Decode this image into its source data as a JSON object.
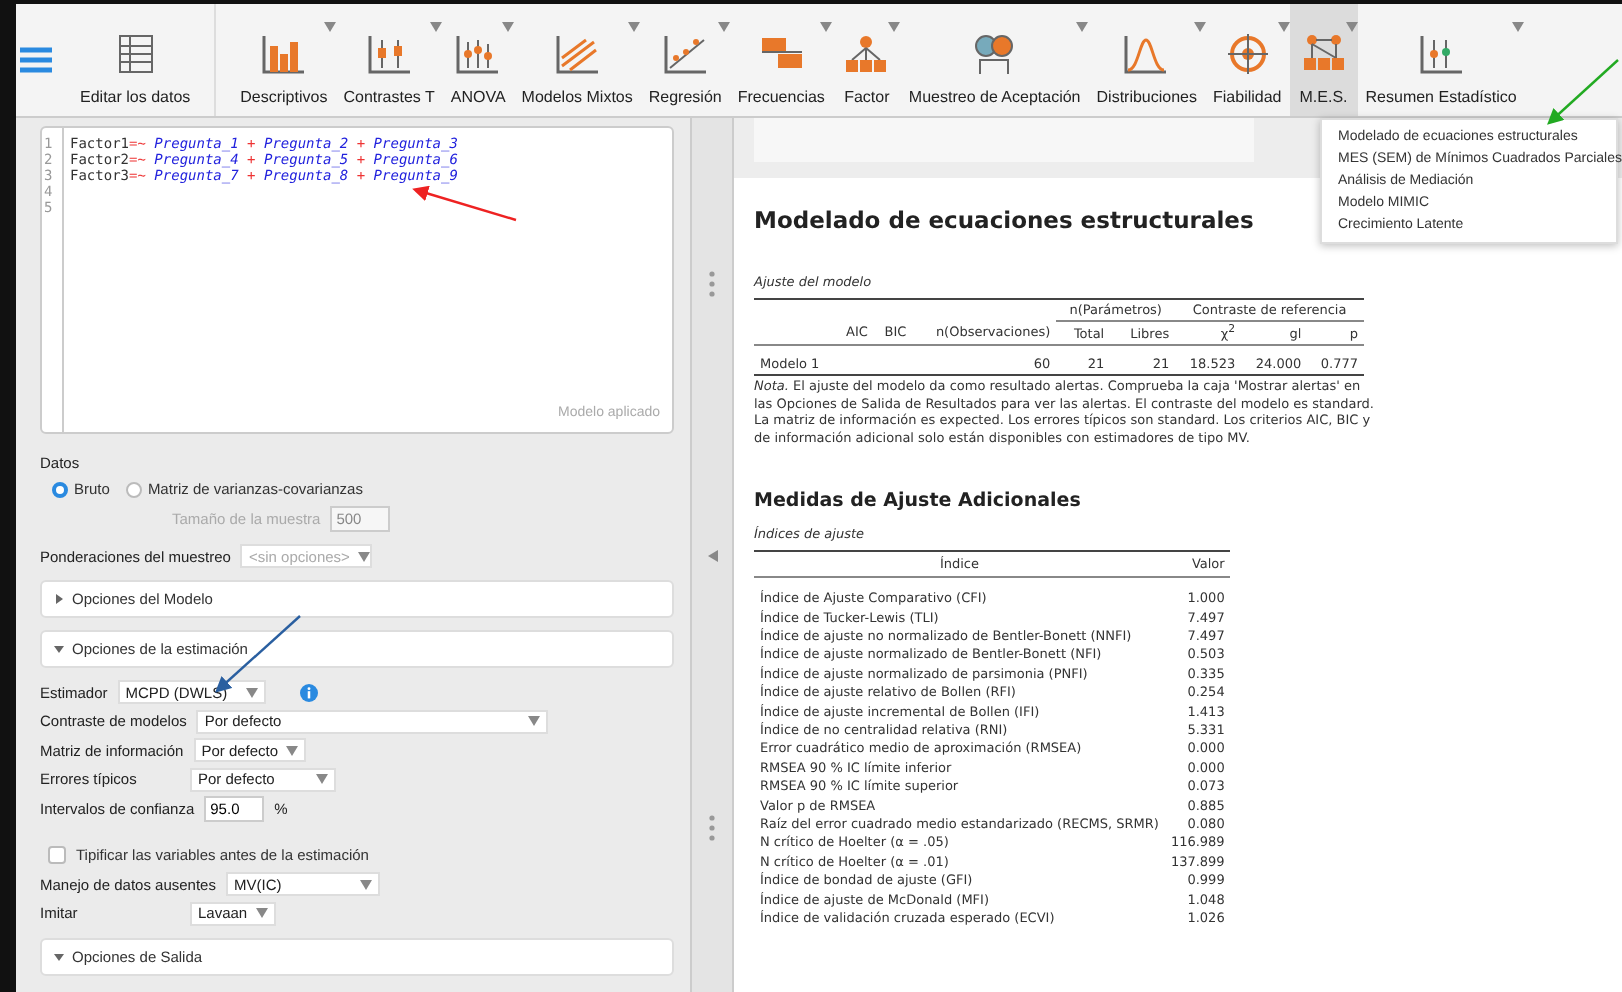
{
  "toolbar": {
    "items": [
      {
        "label": "Editar los datos",
        "has_menu": false,
        "selected": false
      },
      {
        "label": "Descriptivos",
        "has_menu": true,
        "selected": false
      },
      {
        "label": "Contrastes T",
        "has_menu": true,
        "selected": false
      },
      {
        "label": "ANOVA",
        "has_menu": true,
        "selected": false
      },
      {
        "label": "Modelos Mixtos",
        "has_menu": true,
        "selected": false
      },
      {
        "label": "Regresión",
        "has_menu": true,
        "selected": false
      },
      {
        "label": "Frecuencias",
        "has_menu": true,
        "selected": false
      },
      {
        "label": "Factor",
        "has_menu": true,
        "selected": false
      },
      {
        "label": "Muestreo de Aceptación",
        "has_menu": true,
        "selected": false
      },
      {
        "label": "Distribuciones",
        "has_menu": true,
        "selected": false
      },
      {
        "label": "Fiabilidad",
        "has_menu": true,
        "selected": false
      },
      {
        "label": "M.E.S.",
        "has_menu": true,
        "selected": true
      },
      {
        "label": "Resumen Estadístico",
        "has_menu": true,
        "selected": false
      }
    ]
  },
  "dropdown_menu": {
    "items": [
      "Modelado de ecuaciones estructurales",
      "MES (SEM) de Mínimos Cuadrados Parciales",
      "Análisis de Mediación",
      "Modelo MIMIC",
      "Crecimiento Latente"
    ]
  },
  "editor": {
    "line_numbers": [
      "1",
      "2",
      "3",
      "4",
      "5"
    ],
    "lines": [
      [
        {
          "kind": "name",
          "text": "Factor1"
        },
        {
          "kind": "op",
          "text": "=~"
        },
        {
          "kind": "var",
          "text": "Pregunta_1"
        },
        {
          "kind": "op",
          "text": "+"
        },
        {
          "kind": "var",
          "text": "Pregunta_2"
        },
        {
          "kind": "op",
          "text": "+"
        },
        {
          "kind": "var",
          "text": "Pregunta_3"
        }
      ],
      [
        {
          "kind": "name",
          "text": "Factor2"
        },
        {
          "kind": "op",
          "text": "=~"
        },
        {
          "kind": "var",
          "text": "Pregunta_4"
        },
        {
          "kind": "op",
          "text": "+"
        },
        {
          "kind": "var",
          "text": "Pregunta_5"
        },
        {
          "kind": "op",
          "text": "+"
        },
        {
          "kind": "var",
          "text": "Pregunta_6"
        }
      ],
      [
        {
          "kind": "name",
          "text": "Factor3"
        },
        {
          "kind": "op",
          "text": "=~"
        },
        {
          "kind": "var",
          "text": "Pregunta_7"
        },
        {
          "kind": "op",
          "text": "+"
        },
        {
          "kind": "var",
          "text": "Pregunta_8"
        },
        {
          "kind": "op",
          "text": "+"
        },
        {
          "kind": "var",
          "text": "Pregunta_9"
        }
      ]
    ],
    "status": "Modelo aplicado"
  },
  "data_section": {
    "label": "Datos",
    "options": [
      {
        "label": "Bruto",
        "selected": true
      },
      {
        "label": "Matriz de varianzas-covarianzas",
        "selected": false
      }
    ],
    "sample_size": {
      "label": "Tamaño de la muestra",
      "value": "500",
      "disabled": true
    }
  },
  "sampling_weights": {
    "label": "Ponderaciones del muestreo",
    "placeholder": "<sin opciones>"
  },
  "sections": [
    {
      "label": "Opciones del Modelo",
      "expanded": false
    },
    {
      "label": "Opciones de la estimación",
      "expanded": true,
      "fields": [
        {
          "kind": "dropdown",
          "label": "Estimador",
          "value": "MCPD (DWLS)",
          "info": true
        },
        {
          "kind": "dropdown",
          "label": "Contraste de modelos",
          "value": "Por defecto"
        },
        {
          "kind": "dropdown",
          "label": "Matriz de información",
          "value": "Por defecto"
        },
        {
          "kind": "dropdown",
          "label": "Errores típicos",
          "value": "Por defecto"
        },
        {
          "kind": "number",
          "label": "Intervalos de confianza",
          "value": "95.0",
          "unit": "%"
        },
        {
          "kind": "checkbox",
          "label": "Tipificar las variables antes de la estimación",
          "checked": false
        },
        {
          "kind": "dropdown",
          "label": "Manejo de datos ausentes",
          "value": "MV(IC)"
        },
        {
          "kind": "dropdown",
          "label": "Imitar",
          "value": "Lavaan"
        }
      ]
    },
    {
      "label": "Opciones de Salida",
      "expanded": true
    }
  ],
  "results": {
    "title": "Modelado de ecuaciones estructurales",
    "model_fit": {
      "caption": "Ajuste del modelo",
      "group_headers": [
        "n(Parámetros)",
        "Contraste de referencia"
      ],
      "columns": [
        "AIC",
        "BIC",
        "n(Observaciones)",
        "Total",
        "Libres",
        "χ$^{2}$",
        "gl",
        "p"
      ],
      "rows": [
        {
          "model": "Modelo 1",
          "n_obs": "60",
          "total": "21",
          "free": "21",
          "chi2": "18.523",
          "df": "24.000",
          "p": "0.777"
        }
      ],
      "note": "*Nota.*  El ajuste del modelo da como resultado alertas. Comprueba la caja 'Mostrar alertas' en las Opciones de Salida de Resultados para ver las alertas. El contraste del modelo es standard. La matriz de información es expected. Los errores típicos son standard. Los criterios AIC, BIC y de información adicional solo están disponibles con estimadores de tipo MV."
    },
    "additional_title": "Medidas de Ajuste Adicionales",
    "fit_indices": {
      "caption": "Índices de ajuste",
      "columns": [
        "Índice",
        "Valor"
      ],
      "rows": [
        {
          "index": "Índice de Ajuste Comparativo (CFI)",
          "value": "1.000"
        },
        {
          "index": "Índice de Tucker-Lewis (TLI)",
          "value": "7.497"
        },
        {
          "index": "Índice de ajuste no normalizado de Bentler-Bonett (NNFI)",
          "value": "7.497"
        },
        {
          "index": "Índice de ajuste normalizado de Bentler-Bonett (NFI)",
          "value": "0.503"
        },
        {
          "index": "Índice de ajuste normalizado de parsimonia (PNFI)",
          "value": "0.335"
        },
        {
          "index": "Índice de ajuste relativo de Bollen (RFI)",
          "value": "0.254"
        },
        {
          "index": "Índice de ajuste incremental de Bollen (IFI)",
          "value": "1.413"
        },
        {
          "index": "Índice de no centralidad relativa (RNI)",
          "value": "5.331"
        },
        {
          "index": "Error cuadrático medio de aproximación (RMSEA)",
          "value": "0.000"
        },
        {
          "index": "RMSEA 90 % IC límite inferior",
          "value": "0.000"
        },
        {
          "index": "RMSEA 90 % IC límite superior",
          "value": "0.073"
        },
        {
          "index": "Valor p de RMSEA",
          "value": "0.885"
        },
        {
          "index": "Raíz del error cuadrado medio estandarizado (RECMS, SRMR)",
          "value": "0.080"
        },
        {
          "index": "N crítico de Hoelter (α = .05)",
          "value": "116.989"
        },
        {
          "index": "N crítico de Hoelter (α = .01)",
          "value": "137.899"
        },
        {
          "index": "Índice de bondad de ajuste (GFI)",
          "value": "0.999"
        },
        {
          "index": "Índice de ajuste de McDonald (MFI)",
          "value": "1.048"
        },
        {
          "index": "Índice de validación cruzada esperado (ECVI)",
          "value": "1.026"
        }
      ]
    }
  }
}
